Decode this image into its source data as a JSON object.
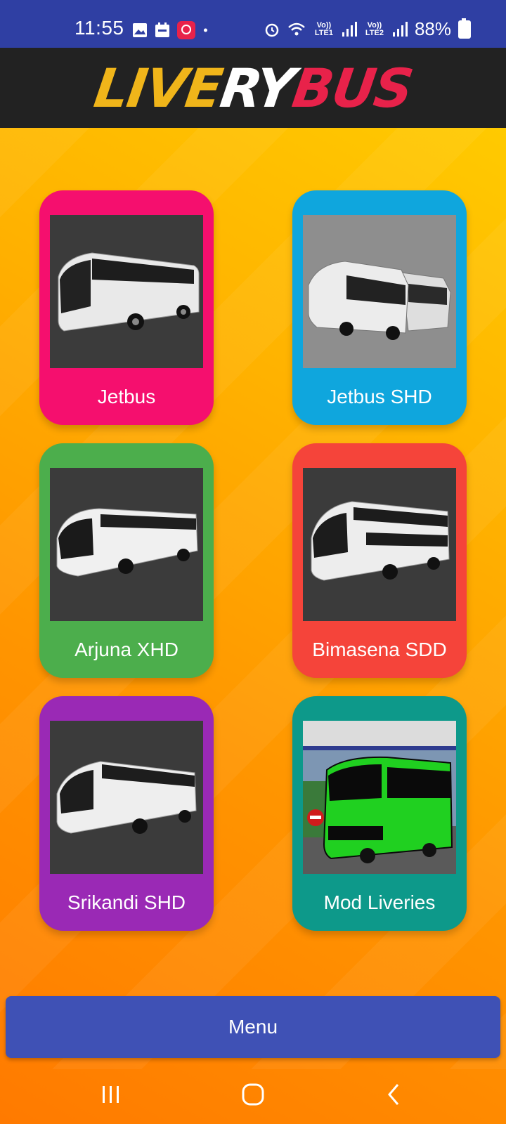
{
  "status_bar": {
    "time": "11:55",
    "battery": "88%",
    "sim1": "Vo)) LTE1",
    "sim2": "Vo)) LTE2",
    "icons": [
      "gallery-icon",
      "calendar-icon",
      "app-icon",
      "dot-icon",
      "alarm-icon",
      "wifi-icon",
      "signal-icon",
      "battery-icon"
    ]
  },
  "header": {
    "logo_part1": "LIVE",
    "logo_part2": "RY",
    "logo_part3": "BUS",
    "colors": {
      "bar": "#222222",
      "accent_yellow": "#f0b51a",
      "accent_red": "#e8224a"
    }
  },
  "grid": {
    "items": [
      {
        "label": "Jetbus",
        "color": "#f50f6e"
      },
      {
        "label": "Jetbus SHD",
        "color": "#0fa6dd"
      },
      {
        "label": "Arjuna XHD",
        "color": "#4cae4c"
      },
      {
        "label": "Bimasena SDD",
        "color": "#f5443a"
      },
      {
        "label": "Srikandi SHD",
        "color": "#9a29b5"
      },
      {
        "label": "Mod Liveries",
        "color": "#0d998a"
      }
    ]
  },
  "menu": {
    "label": "Menu",
    "color": "#3f51b5"
  },
  "nav": {
    "icons": [
      "recent-apps-icon",
      "home-icon",
      "back-icon"
    ]
  }
}
